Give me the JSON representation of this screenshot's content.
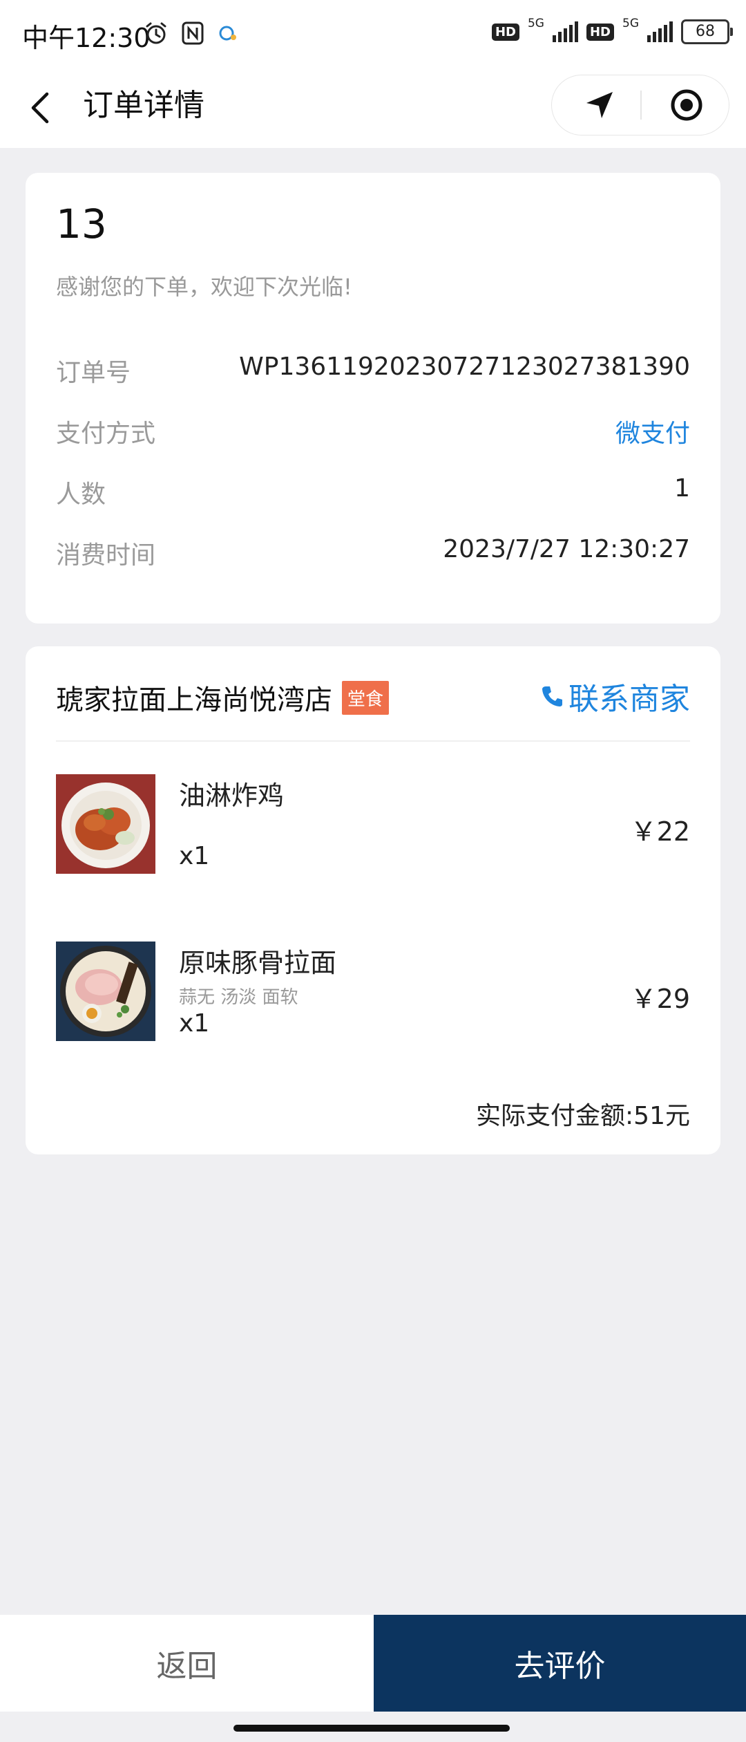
{
  "status_bar": {
    "time": "中午12:30",
    "network1": "5G",
    "network2": "5G",
    "hd_label": "HD",
    "battery": "68"
  },
  "nav": {
    "title": "订单详情"
  },
  "order": {
    "number": "13",
    "thanks": "感谢您的下单，欢迎下次光临!",
    "fields": [
      {
        "label": "订单号",
        "value": "WP13611920230727123027381390"
      },
      {
        "label": "支付方式",
        "value": "微支付"
      },
      {
        "label": "人数",
        "value": "1"
      },
      {
        "label": "消费时间",
        "value": "2023/7/27 12:30:27"
      }
    ]
  },
  "shop": {
    "name": "琥家拉面上海尚悦湾店",
    "tag": "堂食",
    "contact_label": "联系商家",
    "items": [
      {
        "name": "油淋炸鸡",
        "spec": "",
        "qty": "x1",
        "price": "￥22"
      },
      {
        "name": "原味豚骨拉面",
        "spec": "蒜无 汤淡 面软",
        "qty": "x1",
        "price": "￥29"
      }
    ],
    "total": "实际支付金额:51元"
  },
  "bottom": {
    "back_label": "返回",
    "review_label": "去评价"
  },
  "colors": {
    "accent_blue": "#1f85de",
    "primary_dark": "#0c345f",
    "tag_orange": "#ef6f4a",
    "background": "#efeff2"
  }
}
